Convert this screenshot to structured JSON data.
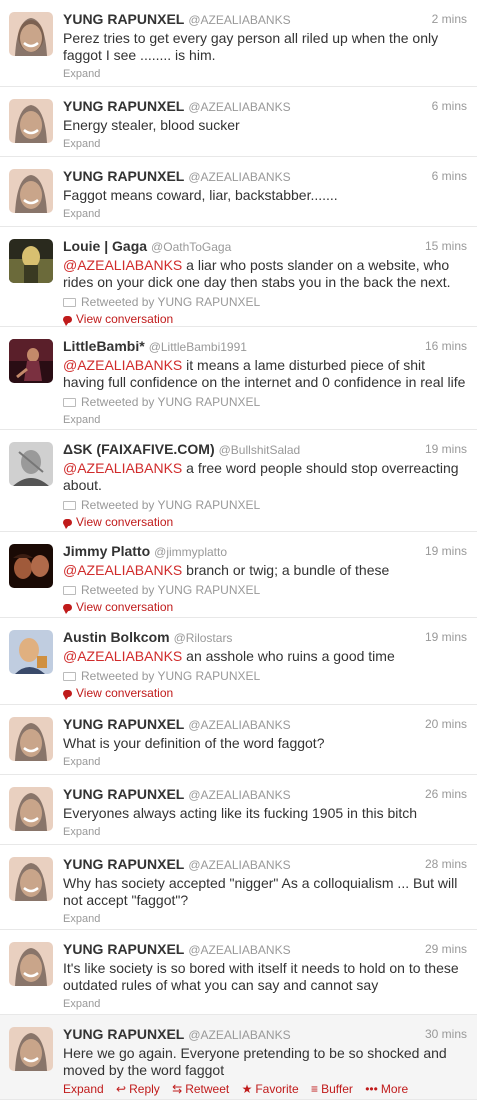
{
  "tweets": [
    {
      "name": "YUNG RAPUNXEL",
      "handle": "@AZEALIABANKS",
      "time": "2 mins",
      "mention": "",
      "text": "Perez tries to get every gay person all riled up when the only faggot I see ........ is him.",
      "retweeted_by": "",
      "expand": "Expand",
      "view_conversation": "",
      "avatar_colors": [
        "#c9a58a",
        "#3a2a22",
        "#e9d0c0"
      ]
    },
    {
      "name": "YUNG RAPUNXEL",
      "handle": "@AZEALIABANKS",
      "time": "6 mins",
      "mention": "",
      "text": "Energy stealer, blood sucker",
      "retweeted_by": "",
      "expand": "Expand",
      "view_conversation": "",
      "avatar_colors": [
        "#c9a58a",
        "#3a2a22",
        "#e9d0c0"
      ]
    },
    {
      "name": "YUNG RAPUNXEL",
      "handle": "@AZEALIABANKS",
      "time": "6 mins",
      "mention": "",
      "text": "Faggot means coward, liar, backstabber.......",
      "retweeted_by": "",
      "expand": "Expand",
      "view_conversation": "",
      "avatar_colors": [
        "#c9a58a",
        "#3a2a22",
        "#e9d0c0"
      ]
    },
    {
      "name": "Louie | Gaga",
      "handle": "@OathToGaga",
      "time": "15 mins",
      "mention": "@AZEALIABANKS",
      "text": " a liar who posts slander on a website, who rides on your dick one day then stabs you in the back the next.",
      "retweeted_by": "Retweeted by YUNG RAPUNXEL",
      "expand": "",
      "view_conversation": "View conversation",
      "avatar_colors": [
        "#6b6a3a",
        "#d8c070",
        "#2a2a1e"
      ]
    },
    {
      "name": "LittleBambi*",
      "handle": "@LittleBambi1991",
      "time": "16 mins",
      "mention": "@AZEALIABANKS",
      "text": " it means a lame disturbed piece of shit having full confidence on the internet and 0 confidence in real life",
      "retweeted_by": "Retweeted by YUNG RAPUNXEL",
      "expand": "Expand",
      "view_conversation": "",
      "avatar_colors": [
        "#5a1f2a",
        "#c48a6a",
        "#2a0d14"
      ]
    },
    {
      "name": "ΔSK (FAIXAFIVE.COM)",
      "handle": "@BullshitSalad",
      "time": "19 mins",
      "mention": "@AZEALIABANKS",
      "text": " a free word people should stop overreacting about.",
      "retweeted_by": "Retweeted by YUNG RAPUNXEL",
      "expand": "",
      "view_conversation": "View conversation",
      "avatar_colors": [
        "#9a9a9a",
        "#555555",
        "#d0d0d0"
      ]
    },
    {
      "name": "Jimmy Platto",
      "handle": "@jimmyplatto",
      "time": "19 mins",
      "mention": "@AZEALIABANKS",
      "text": " branch or twig; a bundle of these",
      "retweeted_by": "Retweeted by YUNG RAPUNXEL",
      "expand": "",
      "view_conversation": "View conversation",
      "avatar_colors": [
        "#3a1d12",
        "#a05a3a",
        "#1a0a05"
      ]
    },
    {
      "name": "Austin Bolkcom",
      "handle": "@Rilostars",
      "time": "19 mins",
      "mention": "@AZEALIABANKS",
      "text": " an asshole who ruins a good time",
      "retweeted_by": "Retweeted by YUNG RAPUNXEL",
      "expand": "",
      "view_conversation": "View conversation",
      "avatar_colors": [
        "#c0cde0",
        "#e0b080",
        "#3a4a6a"
      ]
    },
    {
      "name": "YUNG RAPUNXEL",
      "handle": "@AZEALIABANKS",
      "time": "20 mins",
      "mention": "",
      "text": "What is your definition of the word faggot?",
      "retweeted_by": "",
      "expand": "Expand",
      "view_conversation": "",
      "avatar_colors": [
        "#c9a58a",
        "#3a2a22",
        "#e9d0c0"
      ]
    },
    {
      "name": "YUNG RAPUNXEL",
      "handle": "@AZEALIABANKS",
      "time": "26 mins",
      "mention": "",
      "text": "Everyones always acting like its fucking 1905 in this bitch",
      "retweeted_by": "",
      "expand": "Expand",
      "view_conversation": "",
      "avatar_colors": [
        "#c9a58a",
        "#3a2a22",
        "#e9d0c0"
      ]
    },
    {
      "name": "YUNG RAPUNXEL",
      "handle": "@AZEALIABANKS",
      "time": "28 mins",
      "mention": "",
      "text": "Why has society accepted \"nigger\" As a colloquialism ... But will not accept \"faggot\"?",
      "retweeted_by": "",
      "expand": "Expand",
      "view_conversation": "",
      "avatar_colors": [
        "#c9a58a",
        "#3a2a22",
        "#e9d0c0"
      ]
    },
    {
      "name": "YUNG RAPUNXEL",
      "handle": "@AZEALIABANKS",
      "time": "29 mins",
      "mention": "",
      "text": "It's like society is so bored with itself it needs to hold on to these outdated rules of what you can say and cannot say",
      "retweeted_by": "",
      "expand": "Expand",
      "view_conversation": "",
      "avatar_colors": [
        "#c9a58a",
        "#3a2a22",
        "#e9d0c0"
      ]
    },
    {
      "name": "YUNG RAPUNXEL",
      "handle": "@AZEALIABANKS",
      "time": "30 mins",
      "mention": "",
      "text": "Here we go again. Everyone pretending to be so shocked and moved by the word faggot",
      "retweeted_by": "",
      "expand": "",
      "view_conversation": "",
      "avatar_colors": [
        "#c9a58a",
        "#3a2a22",
        "#e9d0c0"
      ]
    }
  ],
  "actions": {
    "expand": "Expand",
    "reply": "Reply",
    "retweet": "Retweet",
    "favorite": "Favorite",
    "buffer": "Buffer",
    "more": "More"
  },
  "colors": {
    "link": "#c01b1b",
    "muted": "#999999",
    "text": "#333333",
    "hover_bg": "#f5f5f5"
  }
}
